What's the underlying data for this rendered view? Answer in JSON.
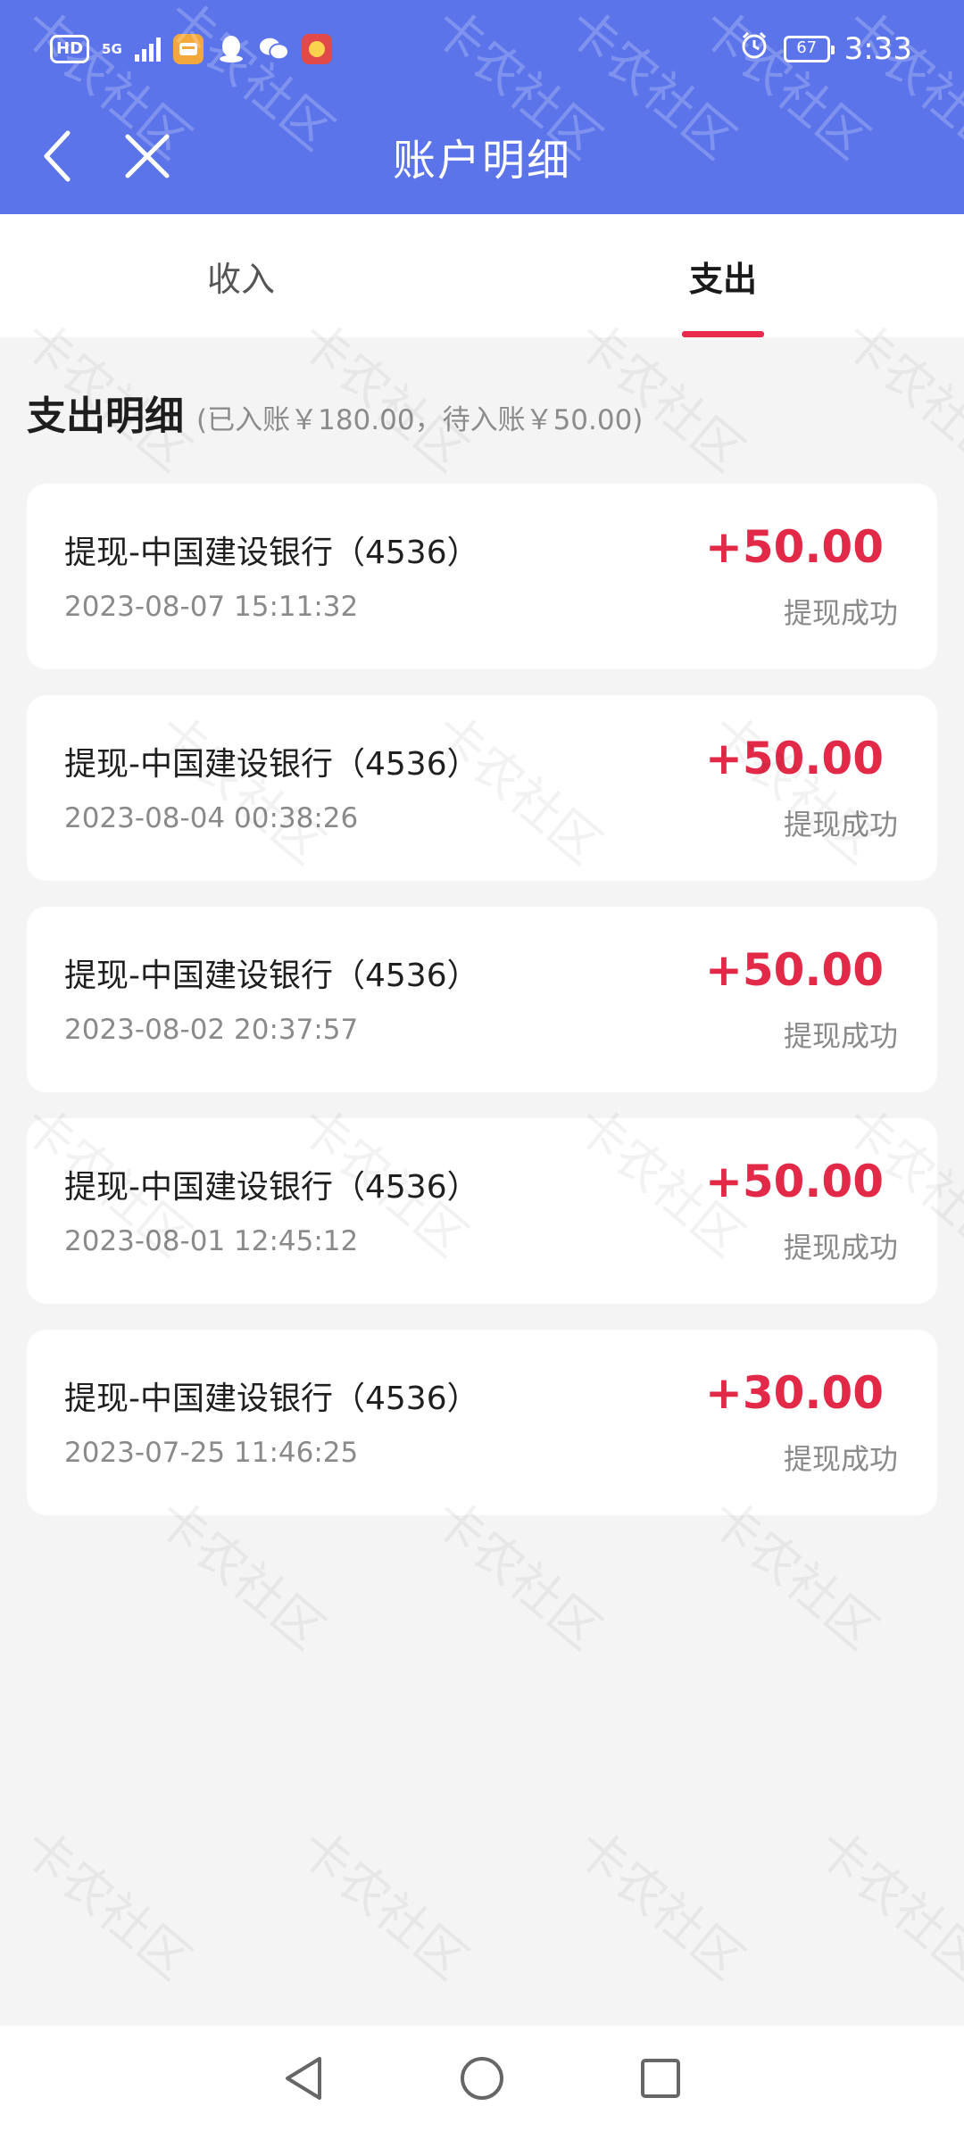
{
  "status_bar": {
    "time": "3:33",
    "battery": "67",
    "network": "5G",
    "hd": "HD"
  },
  "header": {
    "title": "账户明细"
  },
  "tabs": [
    {
      "label": "收入",
      "active": false
    },
    {
      "label": "支出",
      "active": true
    }
  ],
  "section": {
    "title": "支出明细",
    "summary": "(已入账￥180.00，待入账￥50.00)"
  },
  "records": [
    {
      "title": "提现-中国建设银行（4536）",
      "time": "2023-08-07 15:11:32",
      "amount": "+50.00",
      "status": "提现成功"
    },
    {
      "title": "提现-中国建设银行（4536）",
      "time": "2023-08-04 00:38:26",
      "amount": "+50.00",
      "status": "提现成功"
    },
    {
      "title": "提现-中国建设银行（4536）",
      "time": "2023-08-02 20:37:57",
      "amount": "+50.00",
      "status": "提现成功"
    },
    {
      "title": "提现-中国建设银行（4536）",
      "time": "2023-08-01 12:45:12",
      "amount": "+50.00",
      "status": "提现成功"
    },
    {
      "title": "提现-中国建设银行（4536）",
      "time": "2023-07-25 11:46:25",
      "amount": "+30.00",
      "status": "提现成功"
    }
  ],
  "watermark": {
    "text": "卡农社区"
  },
  "icons": {
    "back": "chevron-left-icon",
    "close": "close-icon",
    "alarm": "alarm-icon",
    "nav_back": "triangle-back-icon",
    "nav_home": "circle-home-icon",
    "nav_recent": "square-recent-icon"
  },
  "colors": {
    "header_bg": "#5b74ea",
    "accent_red": "#e22a48",
    "tab_indicator": "#e8294e",
    "page_bg": "#f4f4f4"
  }
}
